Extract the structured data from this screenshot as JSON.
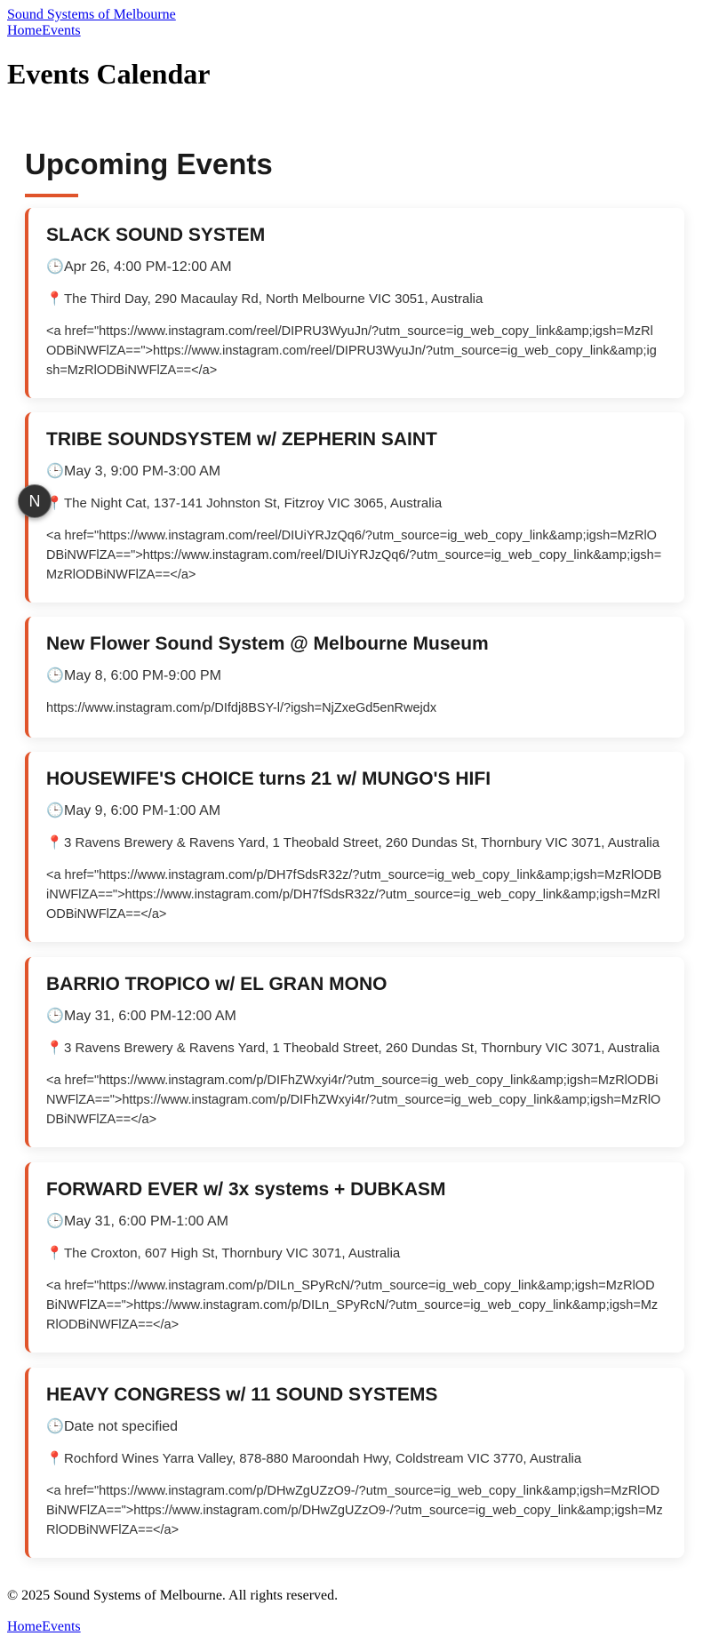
{
  "site": {
    "title": "Sound Systems of Melbourne"
  },
  "nav": {
    "items": [
      {
        "label": "Home"
      },
      {
        "label": "Events"
      }
    ]
  },
  "page": {
    "title": "Events Calendar"
  },
  "section": {
    "title": "Upcoming Events"
  },
  "icons": {
    "clock": "clock-icon",
    "pin": "map-pin-icon"
  },
  "colors": {
    "accent": "#e0542b",
    "link": "#0000ee"
  },
  "avatar": {
    "letter": "N"
  },
  "events": [
    {
      "title": "SLACK SOUND SYSTEM",
      "date": "Apr 26, 4:00 PM-12:00 AM",
      "location": "The Third Day, 290 Macaulay Rd, North Melbourne VIC 3051, Australia",
      "link": "<a href=\"https://www.instagram.com/reel/DIPRU3WyuJn/?utm_source=ig_web_copy_link&amp;igsh=MzRlODBiNWFlZA==\">https://www.instagram.com/reel/DIPRU3WyuJn/?utm_source=ig_web_copy_link&amp;igsh=MzRlODBiNWFlZA==</a>"
    },
    {
      "title": "TRIBE SOUNDSYSTEM w/ ZEPHERIN SAINT",
      "date": "May 3, 9:00 PM-3:00 AM",
      "location": "The Night Cat, 137-141 Johnston St, Fitzroy VIC 3065, Australia",
      "link": "<a href=\"https://www.instagram.com/reel/DIUiYRJzQq6/?utm_source=ig_web_copy_link&amp;igsh=MzRlODBiNWFlZA==\">https://www.instagram.com/reel/DIUiYRJzQq6/?utm_source=ig_web_copy_link&amp;igsh=MzRlODBiNWFlZA==</a>"
    },
    {
      "title": "New Flower Sound System @ Melbourne Museum",
      "date": "May 8, 6:00 PM-9:00 PM",
      "location": null,
      "link": "https://www.instagram.com/p/DIfdj8BSY-l/?igsh=NjZxeGd5enRwejdx"
    },
    {
      "title": "HOUSEWIFE'S CHOICE turns 21 w/ MUNGO'S HIFI",
      "date": "May 9, 6:00 PM-1:00 AM",
      "location": "3 Ravens Brewery & Ravens Yard, 1 Theobald Street, 260 Dundas St, Thornbury VIC 3071, Australia",
      "link": "<a href=\"https://www.instagram.com/p/DH7fSdsR32z/?utm_source=ig_web_copy_link&amp;igsh=MzRlODBiNWFlZA==\">https://www.instagram.com/p/DH7fSdsR32z/?utm_source=ig_web_copy_link&amp;igsh=MzRlODBiNWFlZA==</a>"
    },
    {
      "title": "BARRIO TROPICO w/ EL GRAN MONO",
      "date": "May 31, 6:00 PM-12:00 AM",
      "location": "3 Ravens Brewery & Ravens Yard, 1 Theobald Street, 260 Dundas St, Thornbury VIC 3071, Australia",
      "link": "<a href=\"https://www.instagram.com/p/DIFhZWxyi4r/?utm_source=ig_web_copy_link&amp;igsh=MzRlODBiNWFlZA==\">https://www.instagram.com/p/DIFhZWxyi4r/?utm_source=ig_web_copy_link&amp;igsh=MzRlODBiNWFlZA==</a>"
    },
    {
      "title": "FORWARD EVER w/ 3x systems + DUBKASM",
      "date": "May 31, 6:00 PM-1:00 AM",
      "location": "The Croxton, 607 High St, Thornbury VIC 3071, Australia",
      "link": "<a href=\"https://www.instagram.com/p/DILn_SPyRcN/?utm_source=ig_web_copy_link&amp;igsh=MzRlODBiNWFlZA==\">https://www.instagram.com/p/DILn_SPyRcN/?utm_source=ig_web_copy_link&amp;igsh=MzRlODBiNWFlZA==</a>"
    },
    {
      "title": "HEAVY CONGRESS w/ 11 SOUND SYSTEMS",
      "date": "Date not specified",
      "location": "Rochford Wines Yarra Valley, 878-880 Maroondah Hwy, Coldstream VIC 3770, Australia",
      "link": "<a href=\"https://www.instagram.com/p/DHwZgUZzO9-/?utm_source=ig_web_copy_link&amp;igsh=MzRlODBiNWFlZA==\">https://www.instagram.com/p/DHwZgUZzO9-/?utm_source=ig_web_copy_link&amp;igsh=MzRlODBiNWFlZA==</a>"
    }
  ],
  "footer": {
    "copyright": "© 2025 Sound Systems of Melbourne. All rights reserved."
  }
}
